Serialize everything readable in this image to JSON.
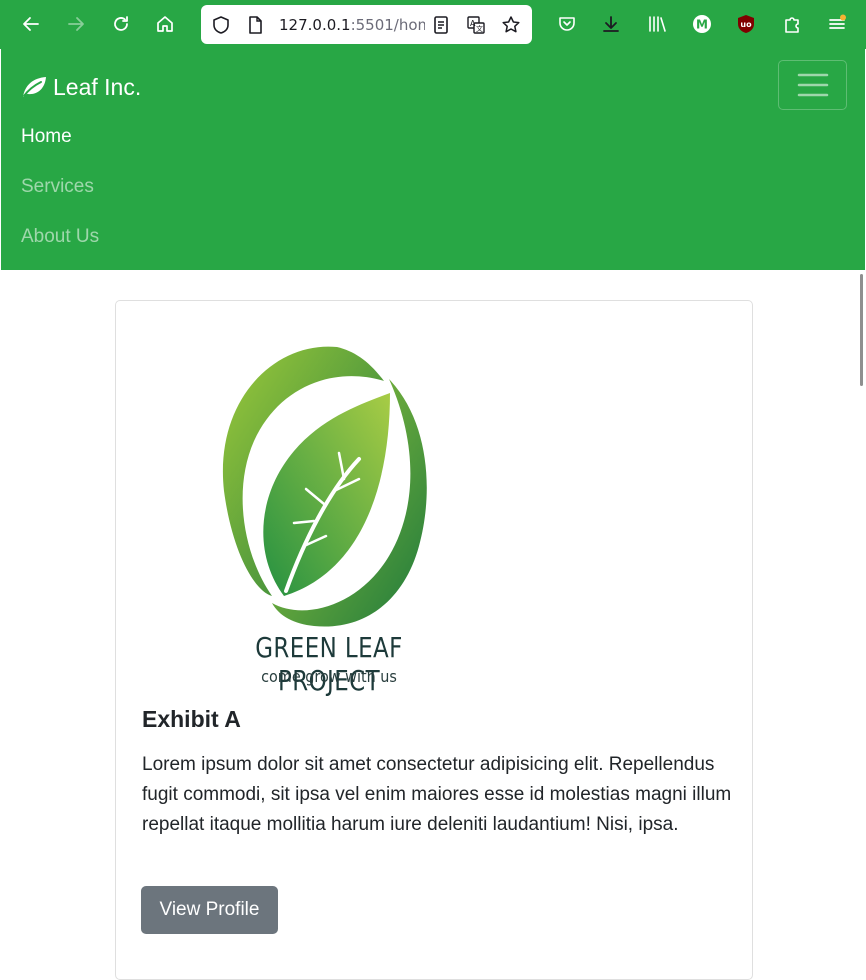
{
  "browser": {
    "url_host": "127.0.0.1",
    "url_rest": ":5501/hom",
    "profile_letter": "M",
    "ublock_label": "uo"
  },
  "navbar": {
    "brand": "Leaf Inc.",
    "links": [
      "Home",
      "Services",
      "About Us"
    ]
  },
  "card": {
    "logo_title": "GREEN LEAF PROJECT",
    "logo_subtitle": "come grow with us",
    "title": "Exhibit A",
    "text": "Lorem ipsum dolor sit amet consectetur adipisicing elit. Repellendus fugit commodi, sit ipsa vel enim maiores esse id molestias magni illum repellat itaque mollitia harum iure deleniti laudantium! Nisi, ipsa.",
    "button": "View Profile"
  },
  "colors": {
    "brand_green": "#28a745",
    "button_gray": "#6c757d"
  },
  "icons": [
    "back-icon",
    "forward-icon",
    "reload-icon",
    "home-icon",
    "shield-icon",
    "page-icon",
    "reader-mode-icon",
    "translate-icon",
    "bookmark-star-icon",
    "pocket-icon",
    "download-icon",
    "library-icon",
    "profile-icon",
    "ublock-icon",
    "extensions-icon",
    "menu-icon",
    "leaf-icon",
    "hamburger-icon"
  ]
}
